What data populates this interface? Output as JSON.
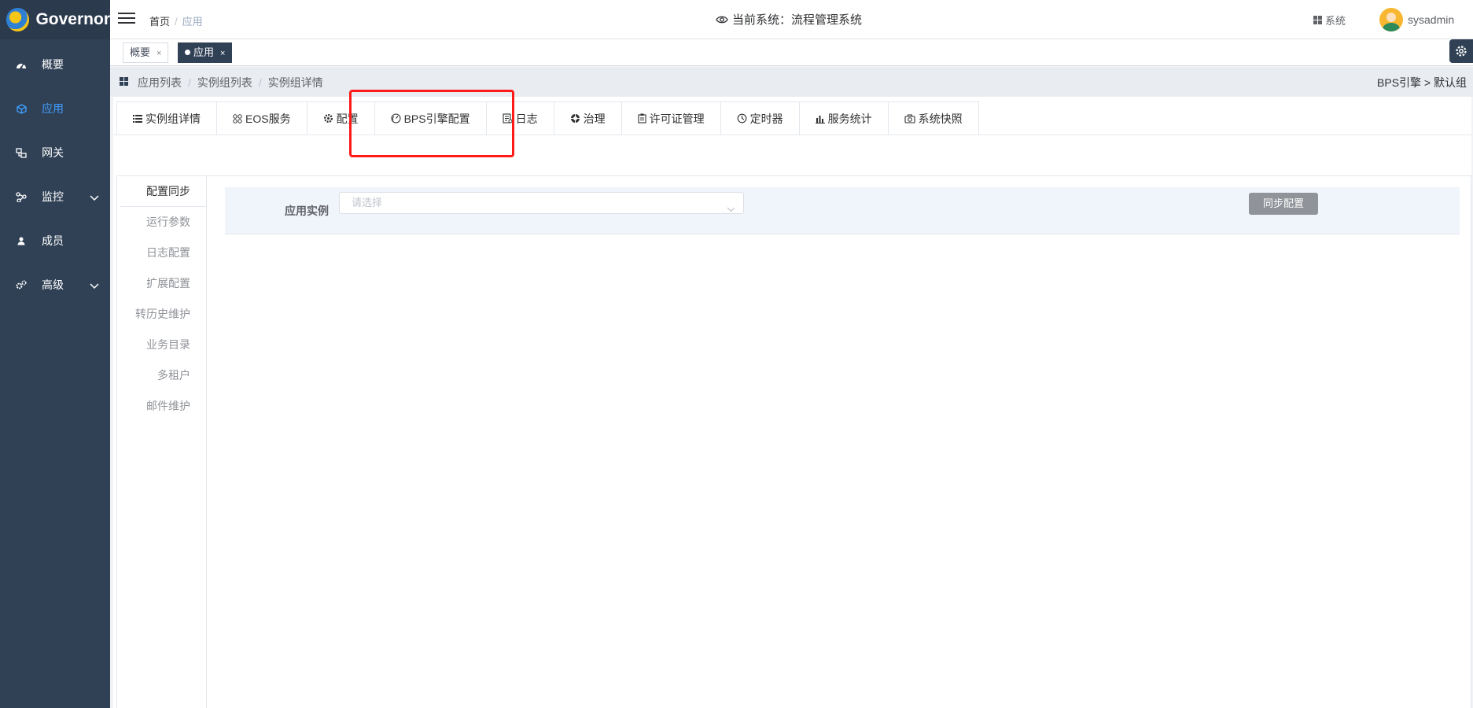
{
  "brand": {
    "name": "Governor"
  },
  "sidebar": {
    "items": [
      {
        "label": "概要",
        "icon": "dashboard-icon"
      },
      {
        "label": "应用",
        "icon": "cube-icon",
        "active": true
      },
      {
        "label": "网关",
        "icon": "gateway-icon"
      },
      {
        "label": "监控",
        "icon": "monitor-icon",
        "expandable": true
      },
      {
        "label": "成员",
        "icon": "user-icon"
      },
      {
        "label": "高级",
        "icon": "gears-icon",
        "expandable": true
      }
    ]
  },
  "header": {
    "breadcrumb": {
      "home": "首页",
      "current": "应用"
    },
    "system_title": "当前系统：流程管理系统",
    "system_button": "系统",
    "username": "sysadmin"
  },
  "tags": [
    {
      "label": "概要",
      "active": false
    },
    {
      "label": "应用",
      "active": true
    }
  ],
  "subcrumb": {
    "items": [
      "应用列表",
      "实例组列表",
      "实例组详情"
    ],
    "right": "BPS引擎 > 默认组"
  },
  "tabs": [
    {
      "label": "实例组详情",
      "icon": "list-icon"
    },
    {
      "label": "EOS服务",
      "icon": "apps-icon"
    },
    {
      "label": "配置",
      "icon": "gear-icon"
    },
    {
      "label": "BPS引擎配置",
      "icon": "gauge-icon"
    },
    {
      "label": "日志",
      "icon": "log-icon"
    },
    {
      "label": "治理",
      "icon": "aperture-icon"
    },
    {
      "label": "许可证管理",
      "icon": "clipboard-icon"
    },
    {
      "label": "定时器",
      "icon": "clock-icon"
    },
    {
      "label": "服务统计",
      "icon": "bar-chart-icon"
    },
    {
      "label": "系统快照",
      "icon": "camera-icon"
    }
  ],
  "side_tabs": [
    {
      "label": "配置同步",
      "active": true
    },
    {
      "label": "运行参数"
    },
    {
      "label": "日志配置"
    },
    {
      "label": "扩展配置"
    },
    {
      "label": "转历史维护"
    },
    {
      "label": "业务目录"
    },
    {
      "label": "多租户"
    },
    {
      "label": "邮件维护"
    }
  ],
  "form": {
    "instance_label": "应用实例",
    "instance_placeholder": "请选择",
    "sync_button": "同步配置"
  },
  "colors": {
    "sidebar_bg": "#304156",
    "active_menu": "#409eff",
    "highlight": "#ff1a1a"
  }
}
